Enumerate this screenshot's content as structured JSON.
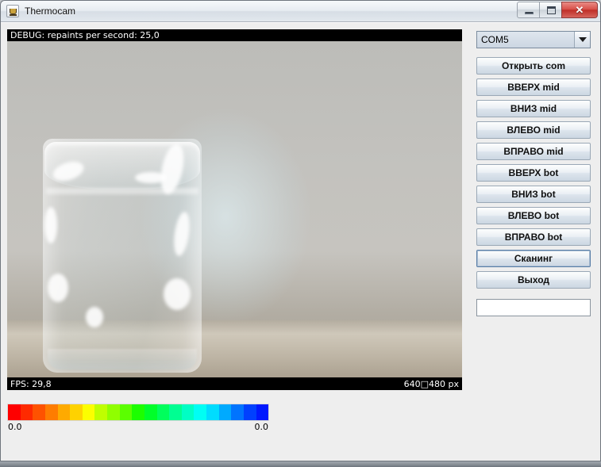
{
  "window": {
    "title": "Thermocam",
    "app_icon": "java-coffee-cup-icon",
    "minimize_label": "",
    "maximize_label": "",
    "close_label": "✕"
  },
  "video": {
    "debug_text": "DEBUG: repaints per second: 25,0",
    "fps_text": "FPS: 29,8",
    "resolution_text": "640□480 px",
    "scene": "webcam view of a transparent drinking glass on a table"
  },
  "controls": {
    "port_select": {
      "value": "COM5",
      "arrow_icon": "chevron-down-icon"
    },
    "buttons": [
      {
        "label": "Открыть com",
        "focused": false
      },
      {
        "label": "ВВЕРХ mid",
        "focused": false
      },
      {
        "label": "ВНИЗ mid",
        "focused": false
      },
      {
        "label": "ВЛЕВО mid",
        "focused": false
      },
      {
        "label": "ВПРАВО mid",
        "focused": false
      },
      {
        "label": "ВВЕРХ bot",
        "focused": false
      },
      {
        "label": "ВНИЗ bot",
        "focused": false
      },
      {
        "label": "ВЛЕВО bot",
        "focused": false
      },
      {
        "label": "ВПРАВО bot",
        "focused": false
      },
      {
        "label": "Сканинг",
        "focused": true
      },
      {
        "label": "Выход",
        "focused": false
      }
    ],
    "status_field": {
      "value": "",
      "placeholder": ""
    }
  },
  "color_scale": {
    "min_label": "0.0",
    "max_label": "0.0",
    "colors": [
      "#fe0000",
      "#fe2a00",
      "#fe5200",
      "#fe7c00",
      "#feaa00",
      "#fed200",
      "#fcfe00",
      "#bffe00",
      "#90fe00",
      "#5bfe00",
      "#1cfe00",
      "#00fe2a",
      "#00fe5c",
      "#00fe92",
      "#00fec4",
      "#00fef4",
      "#00dcfe",
      "#00aafe",
      "#0074fe",
      "#0040fe",
      "#0018fe"
    ]
  },
  "background": {
    "description": "blurred window behind the application"
  }
}
